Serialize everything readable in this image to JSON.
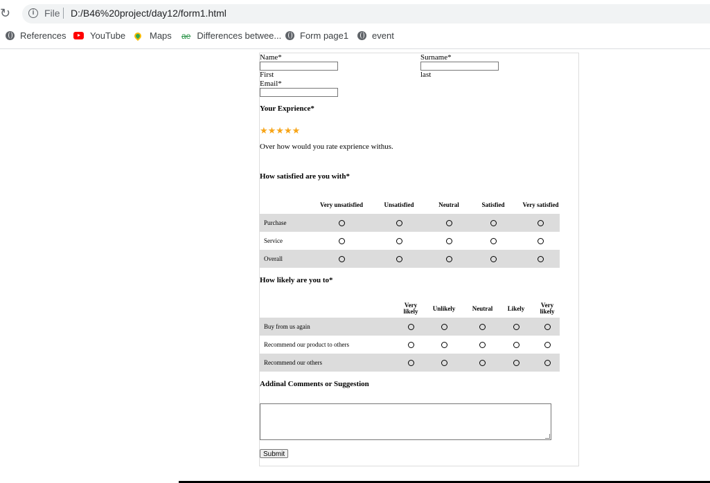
{
  "browser": {
    "scheme": "File",
    "url": "D:/B46%20project/day12/form1.html",
    "bookmarks": [
      {
        "label": "References",
        "icon": "globe-icon"
      },
      {
        "label": "YouTube",
        "icon": "youtube-icon"
      },
      {
        "label": "Maps",
        "icon": "maps-icon"
      },
      {
        "label": "Differences betwee...",
        "icon": "diff-icon"
      },
      {
        "label": "Form page1",
        "icon": "globe-icon"
      },
      {
        "label": "event",
        "icon": "globe-icon"
      }
    ]
  },
  "form": {
    "name_label": "Name*",
    "name_sub": "First",
    "surname_label": "Surname*",
    "surname_sub": "last",
    "email_label": "Email*",
    "experience_heading": "Your Exprience*",
    "star_rating": 5,
    "stars_text": "★★★★★",
    "experience_prompt": "Over how would you rate exprience withus.",
    "satisfied_heading": "How satisfied are you with*",
    "satisfied_columns": [
      "Very unsatisfied",
      "Unsatisfied",
      "Neutral",
      "Satisfied",
      "Very satisfied"
    ],
    "satisfied_rows": [
      "Purchase",
      "Service",
      "Overall"
    ],
    "likely_heading": "How likely are you to*",
    "likely_columns": [
      "Very likely",
      "Unlikely",
      "Neutral",
      "Likely",
      "Very likely"
    ],
    "likely_rows": [
      "Buy from us again",
      "Recommend our product to others",
      "Recommend our others"
    ],
    "comments_heading": "Addinal Comments or Suggestion",
    "submit_label": "Submit"
  },
  "colors": {
    "star": "#f7a518",
    "row_shade": "#dcdcdc",
    "youtube": "#ff0000"
  }
}
